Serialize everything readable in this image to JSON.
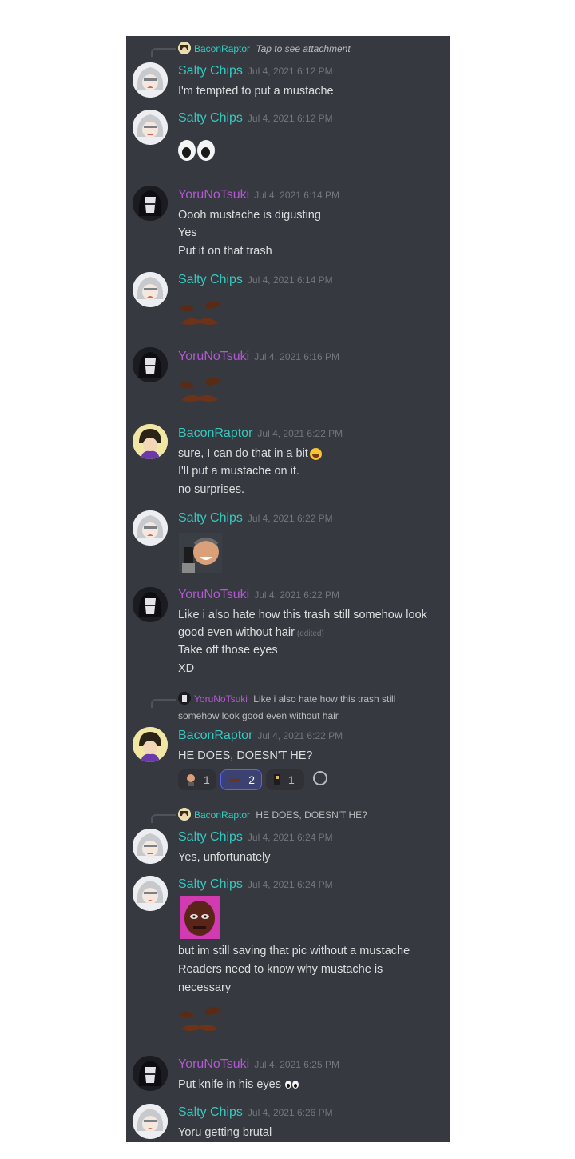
{
  "reply1": {
    "author": "BaconRaptor",
    "text": "Tap to see attachment"
  },
  "reply2": {
    "author": "YoruNoTsuki",
    "line1": "Like i also hate how this trash still",
    "line2": "somehow look good even without hair"
  },
  "reply3": {
    "author": "BaconRaptor",
    "text": "HE DOES, DOESN'T HE?"
  },
  "messages": [
    {
      "author": "Salty Chips",
      "time": "Jul 4, 2021 6:12 PM",
      "lines": [
        "I'm tempted to put a mustache"
      ]
    },
    {
      "author": "Salty Chips",
      "time": "Jul 4, 2021 6:12 PM",
      "emoji": "eyes-emoji"
    },
    {
      "author": "YoruNoTsuki",
      "time": "Jul 4, 2021 6:14 PM",
      "lines": [
        "Oooh mustache is digusting",
        "Yes",
        "Put it on that trash"
      ]
    },
    {
      "author": "Salty Chips",
      "time": "Jul 4, 2021 6:14 PM",
      "emoji": "mustache-emoji"
    },
    {
      "author": "YoruNoTsuki",
      "time": "Jul 4, 2021 6:16 PM",
      "emoji": "mustache-emoji"
    },
    {
      "author": "BaconRaptor",
      "time": "Jul 4, 2021 6:22 PM",
      "lines": [
        "sure, I can do that in a bit",
        "I'll put a mustache on it.",
        "no surprises."
      ]
    },
    {
      "author": "Salty Chips",
      "time": "Jul 4, 2021 6:22 PM",
      "emoji": "laughing-man-emoji"
    },
    {
      "author": "YoruNoTsuki",
      "time": "Jul 4, 2021 6:22 PM",
      "lines": [
        "Like i also hate how this trash still somehow look",
        "good even without hair",
        "Take off those eyes",
        "XD"
      ],
      "edited": "(edited)"
    },
    {
      "author": "BaconRaptor",
      "time": "Jul 4, 2021 6:22 PM",
      "lines": [
        "HE DOES, DOESN'T HE?"
      ]
    },
    {
      "author": "Salty Chips",
      "time": "Jul 4, 2021 6:24 PM",
      "lines": [
        "Yes, unfortunately"
      ]
    },
    {
      "author": "Salty Chips",
      "time": "Jul 4, 2021 6:24 PM",
      "lines": [
        "but im still saving that pic without a mustache",
        "Readers need to know why mustache is",
        "necessary"
      ]
    },
    {
      "author": "YoruNoTsuki",
      "time": "Jul 4, 2021 6:25 PM",
      "lines": [
        "Put knife in his eyes"
      ]
    },
    {
      "author": "Salty Chips",
      "time": "Jul 4, 2021 6:26 PM",
      "lines": [
        "Yoru getting brutal"
      ]
    }
  ],
  "reactions": [
    {
      "emoji": "person-emoji",
      "count": "1"
    },
    {
      "emoji": "mustache-emoji",
      "count": "2",
      "active": true
    },
    {
      "emoji": "phone-emoji",
      "count": "1"
    }
  ],
  "colors": {
    "background": "#36393f",
    "text": "#dcddde",
    "timestamp": "#72767d",
    "cyan_name": "#35c8c0",
    "purple_name": "#b158d2",
    "reaction_active": "#5865f2"
  }
}
